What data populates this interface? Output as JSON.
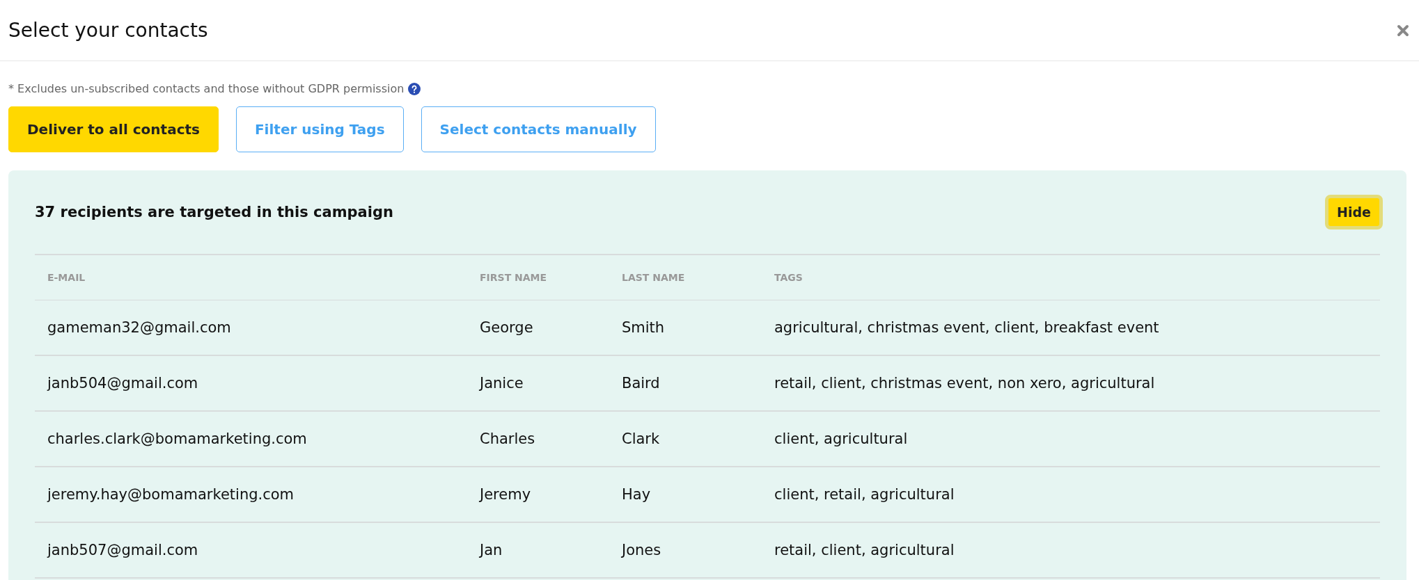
{
  "dialog": {
    "title": "Select your contacts"
  },
  "note": "* Excludes un-subscribed contacts and those without GDPR permission",
  "modes": [
    {
      "label": "Deliver to all contacts",
      "selected": true
    },
    {
      "label": "Filter using Tags",
      "selected": false
    },
    {
      "label": "Select contacts manually",
      "selected": false
    }
  ],
  "summary": {
    "text": "37 recipients are targeted in this campaign",
    "hide_button": "Hide"
  },
  "table": {
    "columns": [
      "E-MAIL",
      "FIRST NAME",
      "LAST NAME",
      "TAGS"
    ],
    "rows": [
      [
        "gameman32@gmail.com",
        "George",
        "Smith",
        "agricultural, christmas event, client, breakfast event"
      ],
      [
        "janb504@gmail.com",
        "Janice",
        "Baird",
        "retail, client, christmas event, non xero, agricultural"
      ],
      [
        "charles.clark@bomamarketing.com",
        "Charles",
        "Clark",
        "client, agricultural"
      ],
      [
        "jeremy.hay@bomamarketing.com",
        "Jeremy",
        "Hay",
        "client, retail, agricultural"
      ],
      [
        "janb507@gmail.com",
        "Jan",
        "Jones",
        "retail, client, agricultural"
      ]
    ]
  }
}
